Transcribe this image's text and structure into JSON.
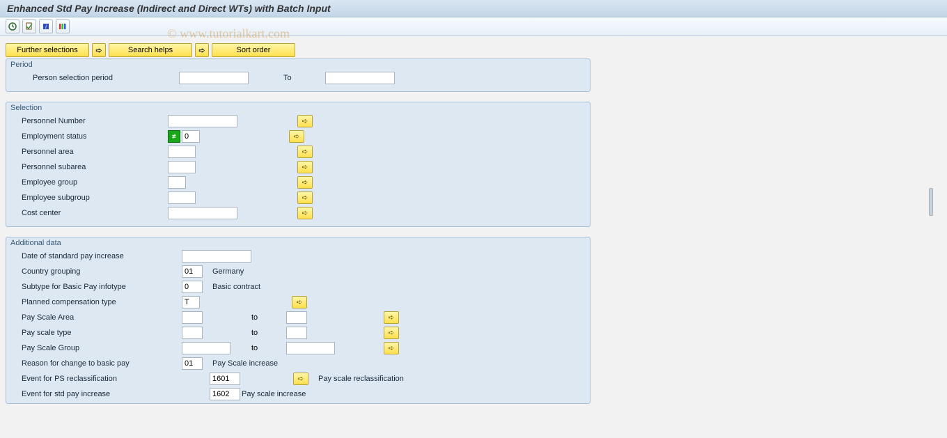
{
  "title": "Enhanced Std Pay Increase (Indirect and Direct WTs) with Batch Input",
  "watermark": "© www.tutorialkart.com",
  "toolbar": {
    "execute_icon": "⚙",
    "variant_icon": "📄",
    "info_icon": "i",
    "color_icon": "▮"
  },
  "sel_buttons": {
    "further": "Further selections",
    "search": "Search helps",
    "sort": "Sort order"
  },
  "period": {
    "title": "Period",
    "person_sel_label": "Person selection period",
    "to_label": "To",
    "from_value": "",
    "to_value": ""
  },
  "selection": {
    "title": "Selection",
    "rows": {
      "pernr": {
        "label": "Personnel Number",
        "value": ""
      },
      "empstat": {
        "label": "Employment status",
        "value": "0",
        "ne_icon": "≠"
      },
      "persarea": {
        "label": "Personnel area",
        "value": ""
      },
      "perssub": {
        "label": "Personnel subarea",
        "value": ""
      },
      "empgrp": {
        "label": "Employee group",
        "value": ""
      },
      "empsub": {
        "label": "Employee subgroup",
        "value": ""
      },
      "costctr": {
        "label": "Cost center",
        "value": ""
      }
    }
  },
  "additional": {
    "title": "Additional data",
    "date_std_label": "Date of standard pay increase",
    "date_std_value": "",
    "country_label": "Country grouping",
    "country_value": "01",
    "country_desc": "Germany",
    "subtype_label": "Subtype for Basic Pay infotype",
    "subtype_value": "0",
    "subtype_desc": "Basic contract",
    "planned_label": "Planned compensation type",
    "planned_value": "T",
    "ps_area_label": "Pay Scale Area",
    "ps_type_label": "Pay scale type",
    "ps_group_label": "Pay Scale Group",
    "to_label": "to",
    "reason_label": "Reason for change to basic pay",
    "reason_value": "01",
    "reason_desc": "Pay Scale increase",
    "event_ps_label": "Event for PS reclassification",
    "event_ps_value": "1601",
    "event_ps_desc": "Pay scale reclassification",
    "event_std_label": "Event for std pay increase",
    "event_std_value": "1602",
    "event_std_desc": "Pay scale increase"
  }
}
